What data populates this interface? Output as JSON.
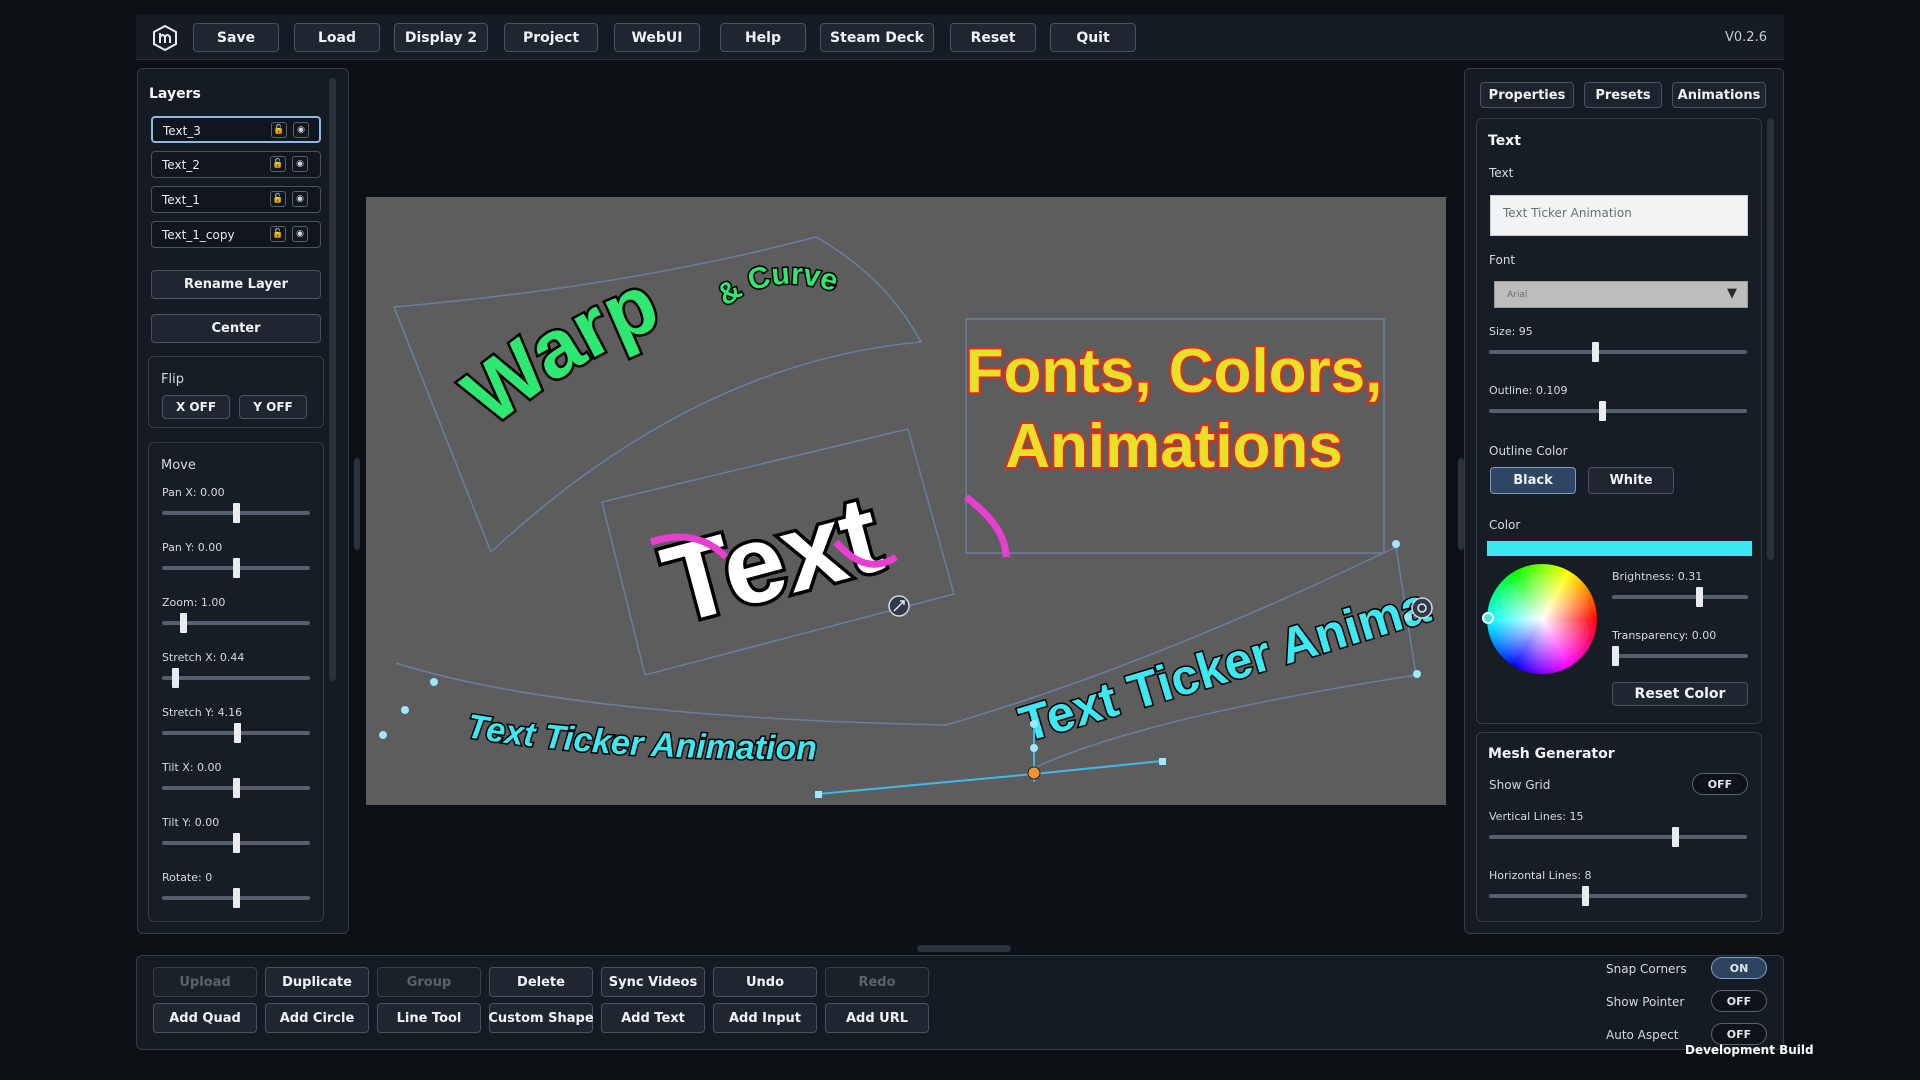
{
  "app": {
    "version": "V0.2.6",
    "logo": "hm-logo"
  },
  "menu": [
    "Save",
    "Load",
    "Display 2",
    "Project",
    "WebUI",
    "Help",
    "Steam Deck",
    "Reset",
    "Quit"
  ],
  "layers": {
    "title": "Layers",
    "items": [
      "Text_3",
      "Text_2",
      "Text_1",
      "Text_1_copy"
    ],
    "selected": "Text_3",
    "rename_label": "Rename Layer",
    "center_label": "Center",
    "flip": {
      "title": "Flip",
      "x_label": "X OFF",
      "y_label": "Y OFF"
    },
    "move": {
      "title": "Move",
      "sliders": [
        {
          "label": "Pan X: 0.00",
          "value": 0.5
        },
        {
          "label": "Pan Y: 0.00",
          "value": 0.5
        },
        {
          "label": "Zoom: 1.00",
          "value": 0.13
        },
        {
          "label": "Stretch X: 0.44",
          "value": 0.07
        },
        {
          "label": "Stretch Y: 4.16",
          "value": 0.51
        },
        {
          "label": "Tilt X: 0.00",
          "value": 0.5
        },
        {
          "label": "Tilt Y: 0.00",
          "value": 0.5
        },
        {
          "label": "Rotate: 0",
          "value": 0.5
        }
      ]
    }
  },
  "canvas": {
    "warp_main": "Warp",
    "warp_small": "& Curve",
    "fonts_line1": "Fonts, Colors,",
    "fonts_line2": "Animations",
    "text_word": "Text",
    "ticker_text": "Text Ticker Animation"
  },
  "right": {
    "tabs": [
      "Properties",
      "Presets",
      "Animations"
    ],
    "text_section": {
      "title": "Text",
      "text_label": "Text",
      "text_value": "Text Ticker Animation",
      "font_label": "Font",
      "font_value": "Arial",
      "size": {
        "label": "Size: 95",
        "value": 0.41
      },
      "outline": {
        "label": "Outline: 0.109",
        "value": 0.44
      },
      "outline_color_label": "Outline Color",
      "black_label": "Black",
      "white_label": "White",
      "color_label": "Color",
      "color_value": "#3ce8f2",
      "brightness": {
        "label": "Brightness: 0.31",
        "value": 0.65
      },
      "transparency": {
        "label": "Transparency: 0.00",
        "value": 0.0
      },
      "reset_color_label": "Reset Color"
    },
    "mesh": {
      "title": "Mesh Generator",
      "show_grid_label": "Show Grid",
      "show_grid_value": "OFF",
      "vertical": {
        "label": "Vertical Lines: 15",
        "value": 0.73
      },
      "horizontal": {
        "label": "Horizontal Lines: 8",
        "value": 0.37
      }
    }
  },
  "bottom": {
    "row1": [
      {
        "label": "Upload",
        "enabled": false
      },
      {
        "label": "Duplicate",
        "enabled": true
      },
      {
        "label": "Group",
        "enabled": false
      },
      {
        "label": "Delete",
        "enabled": true
      },
      {
        "label": "Sync Videos",
        "enabled": true
      },
      {
        "label": "Undo",
        "enabled": true
      },
      {
        "label": "Redo",
        "enabled": false
      }
    ],
    "row2": [
      "Add Quad",
      "Add Circle",
      "Line Tool",
      "Custom Shape",
      "Add Text",
      "Add Input",
      "Add URL"
    ],
    "toggles": [
      {
        "label": "Snap Corners",
        "value": "ON"
      },
      {
        "label": "Show Pointer",
        "value": "OFF"
      },
      {
        "label": "Auto Aspect",
        "value": "OFF"
      }
    ],
    "dev_build": "Development Build"
  }
}
